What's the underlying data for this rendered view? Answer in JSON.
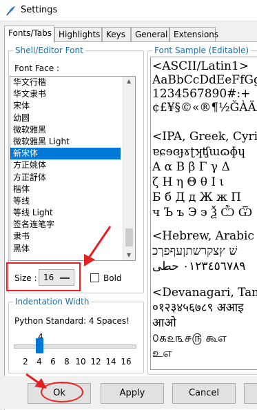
{
  "window": {
    "title": "Settings"
  },
  "tabs": [
    {
      "label": "Fonts/Tabs",
      "active": true
    },
    {
      "label": "Highlights"
    },
    {
      "label": "Keys"
    },
    {
      "label": "General"
    },
    {
      "label": "Extensions"
    }
  ],
  "font_group": {
    "legend": "Shell/Editor Font",
    "face_label": "Font Face :",
    "fonts": [
      "华文行楷",
      "华文隶书",
      "宋体",
      "幼圆",
      "微软雅黑",
      "微软雅黑 Light",
      "新宋体",
      "方正姚体",
      "方正舒体",
      "楷体",
      "等线",
      "等线 Light",
      "签名连笔字",
      "隶书",
      "黑体"
    ],
    "selected_index": 6,
    "size_label": "Size :",
    "size_value": "16",
    "bold_label": "Bold"
  },
  "indent_group": {
    "legend": "Indentation Width",
    "text": "Python Standard: 4 Spaces!",
    "current_value": "4",
    "ticks": [
      "2",
      "4",
      "6",
      "8",
      "10",
      "12",
      "14",
      "16"
    ]
  },
  "sample": {
    "legend": "Font Sample (Editable)",
    "lines": [
      "<ASCII/Latin1>",
      "AaBbCcDdEeFfGgH",
      "1234567890#:+",
      "¢£¥§©«®¶½ĞÀÄÃÇ",
      "",
      "<IPA, Greek, Cyri",
      "ɐɕɘɞɟɤʈʞʧɯɷɸɥ",
      "Α α Β β Γ γ Δ",
      "ζ Η η Θ θ Ι ι",
      "Б б Д д Ж ж П",
      "ч Ъ ъ Э э Ѯ Ѽ Ѿ",
      "",
      "<Hebrew, Arabic",
      "שׁ ץצקרשתןעףפךכ",
      "٠١٢٣٤٥٦٧٨٩ حطى",
      "",
      "<Devanagari, Tam",
      "०१२३४५६७८९ अआइ",
      "आओ",
      "௦௧௨௩௪௫ கூஎ",
      "உஎ"
    ]
  },
  "buttons": {
    "ok": "Ok",
    "apply": "Apply",
    "cancel": "Cancel"
  },
  "annotation_color": "#e22222",
  "selection_color": "#0078d7"
}
